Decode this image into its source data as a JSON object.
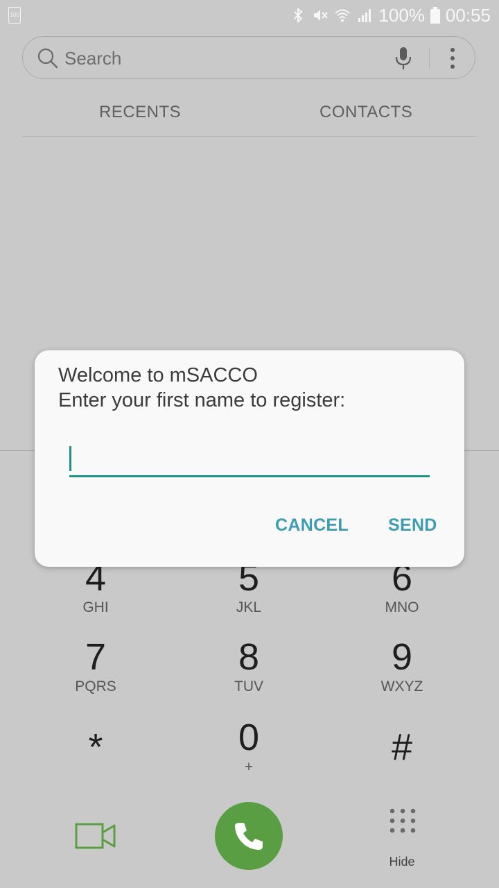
{
  "status_bar": {
    "left_icon": "battery-100-notification-icon",
    "left_text": "100",
    "battery": "100%",
    "time": "00:55",
    "icons": [
      "bluetooth-icon",
      "mute-vibrate-icon",
      "wifi-icon",
      "signal-icon",
      "battery-icon"
    ]
  },
  "search": {
    "placeholder": "Search"
  },
  "tabs": [
    {
      "label": "RECENTS"
    },
    {
      "label": "CONTACTS"
    }
  ],
  "dialog": {
    "line1": "Welcome to mSACCO",
    "line2": "Enter your first name to register:",
    "input_value": "",
    "cancel_label": "CANCEL",
    "send_label": "SEND"
  },
  "keypad": [
    {
      "digit": "4",
      "letters": "GHI"
    },
    {
      "digit": "5",
      "letters": "JKL"
    },
    {
      "digit": "6",
      "letters": "MNO"
    },
    {
      "digit": "7",
      "letters": "PQRS"
    },
    {
      "digit": "8",
      "letters": "TUV"
    },
    {
      "digit": "9",
      "letters": "WXYZ"
    },
    {
      "digit": "*",
      "letters": ""
    },
    {
      "digit": "0",
      "letters": "+"
    },
    {
      "digit": "#",
      "letters": ""
    }
  ],
  "bottom": {
    "hide_label": "Hide"
  },
  "colors": {
    "accent": "#199486",
    "button_text": "#3d9bb2",
    "call_green": "#5a9e44",
    "background": "#c9c9c9"
  }
}
